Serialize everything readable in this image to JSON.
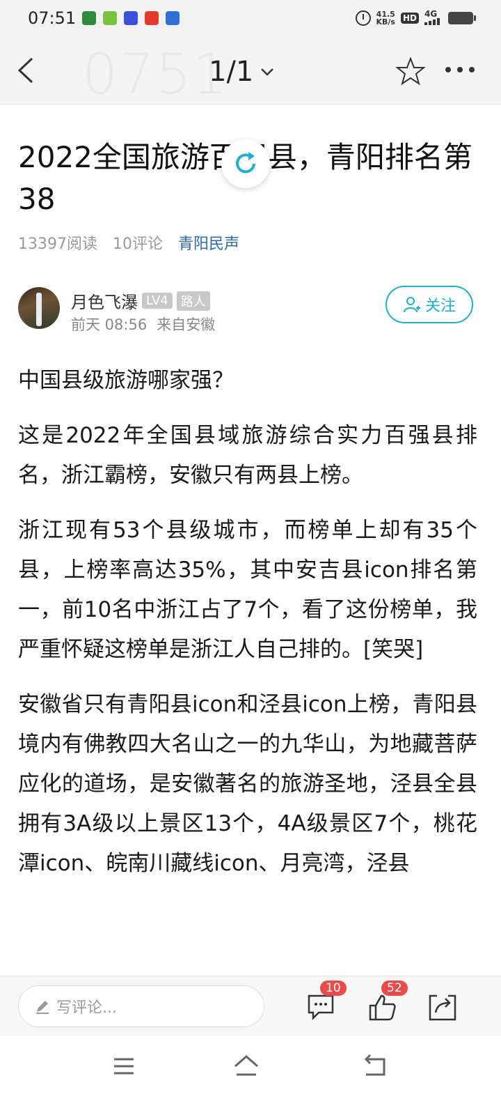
{
  "status_bar": {
    "time": "07:51",
    "speed_value": "41.5",
    "speed_unit": "KB/s",
    "hd": "HD",
    "network": "4G",
    "app_icons": [
      "app-icon",
      "app-icon",
      "app-icon",
      "app-icon",
      "app-icon"
    ]
  },
  "nav": {
    "ghost_time": "0751",
    "page_indicator": "1/1"
  },
  "article": {
    "title": "2022全国旅游百强县，青阳排名第38",
    "reads": "13397阅读",
    "comments": "10评论",
    "source": "青阳民声"
  },
  "author": {
    "name": "月色飞瀑",
    "level": "LV4",
    "role": "路人",
    "time": "前天 08:56",
    "from": "来自安徽",
    "follow_label": "关注"
  },
  "body": {
    "paragraphs": [
      "中国县级旅游哪家强？",
      "这是2022年全国县域旅游综合实力百强县排名，浙江霸榜，安徽只有两县上榜。",
      "浙江现有53个县级城市，而榜单上却有35个县，上榜率高达35%，其中安吉县icon排名第一，前10名中浙江占了7个，看了这份榜单，我严重怀疑这榜单是浙江人自己排的。[笑哭]",
      "安徽省只有青阳县icon和泾县icon上榜，青阳县境内有佛教四大名山之一的九华山，为地藏菩萨应化的道场，是安徽著名的旅游圣地，泾县全县拥有3A级以上景区13个，4A级景区7个，桃花潭icon、皖南川藏线icon、月亮湾，泾县"
    ]
  },
  "bottom_bar": {
    "comment_placeholder": "写评论...",
    "comment_count": "10",
    "like_count": "52"
  },
  "colors": {
    "accent": "#21aeca",
    "source_link": "#2b6aa8",
    "badge_red": "#e94b4b"
  }
}
